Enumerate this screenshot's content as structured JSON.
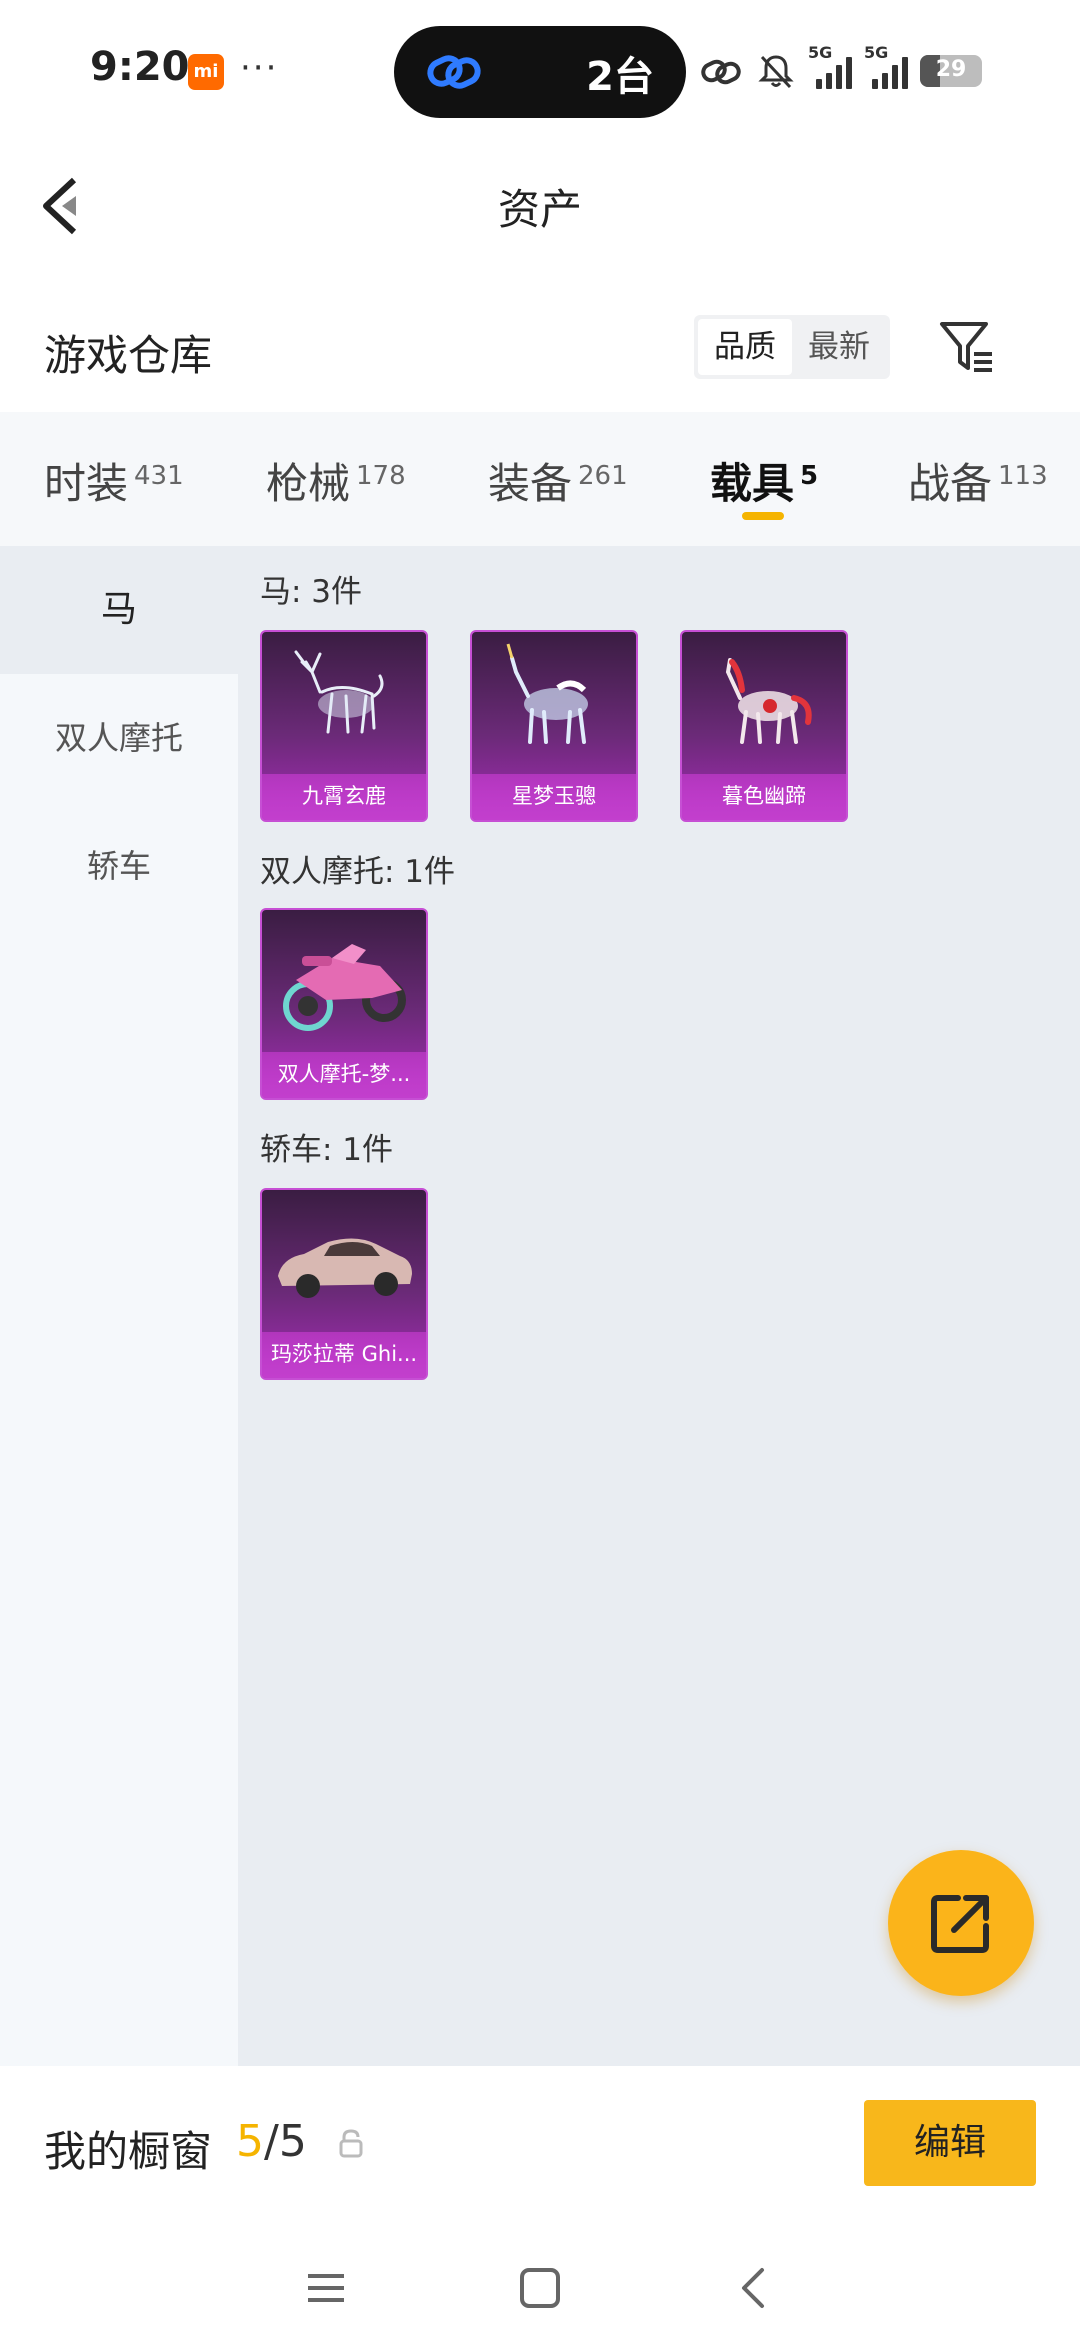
{
  "status_bar": {
    "time": "9:20",
    "mi_badge": "mi",
    "dots": "···",
    "island_text": "2台",
    "sim1": "5G",
    "sim2": "5G",
    "battery": "29"
  },
  "nav": {
    "title": "资产"
  },
  "warehouse": {
    "title": "游戏仓库",
    "sort_options": [
      "品质",
      "最新"
    ],
    "active_sort": "品质"
  },
  "tabs": [
    {
      "label": "时装",
      "count": "431"
    },
    {
      "label": "枪械",
      "count": "178"
    },
    {
      "label": "装备",
      "count": "261"
    },
    {
      "label": "载具",
      "count": "5",
      "active": true
    },
    {
      "label": "战备",
      "count": "113"
    }
  ],
  "sidebar": {
    "items": [
      {
        "label": "马",
        "active": true
      },
      {
        "label": "双人摩托"
      },
      {
        "label": "轿车"
      }
    ]
  },
  "groups": [
    {
      "title": "马: 3件",
      "items": [
        "九霄玄鹿",
        "星梦玉骢",
        "暮色幽蹄"
      ]
    },
    {
      "title": "双人摩托: 1件",
      "items": [
        "双人摩托-梦..."
      ]
    },
    {
      "title": "轿车: 1件",
      "items": [
        "玛莎拉蒂 Ghi..."
      ]
    }
  ],
  "window_bar": {
    "label": "我的橱窗",
    "current": "5",
    "total": "/5",
    "edit_label": "编辑"
  },
  "colors": {
    "accent": "#f5b400",
    "card_purple": "#a52cb5"
  }
}
